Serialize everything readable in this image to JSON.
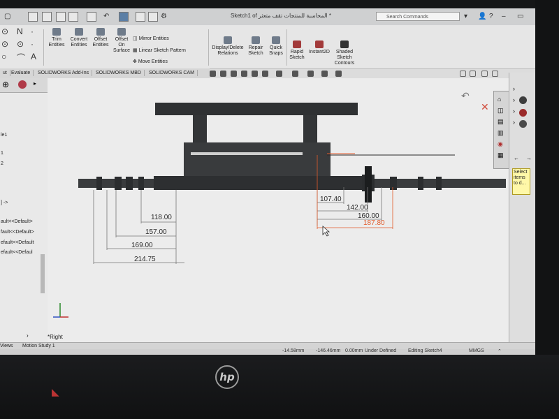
{
  "window": {
    "title": "Sketch1 of المحاسبة للمنتجات تقف متعثر *",
    "search_placeholder": "Search Commands"
  },
  "ribbon": {
    "trim": "Trim Entities",
    "convert": "Convert Entities",
    "offset": "Offset Entities",
    "offset_surface": "Offset On Surface",
    "mirror": "Mirror Entities",
    "linear_pattern": "Linear Sketch Pattern",
    "move": "Move Entities",
    "display_relations": "Display/Delete Relations",
    "repair": "Repair Sketch",
    "quick_snaps": "Quick Snaps",
    "rapid": "Rapid Sketch",
    "instant2d": "Instant2D",
    "shaded": "Shaded Sketch Contours"
  },
  "tabs": [
    "ut",
    "Evaluate",
    "SOLIDWORKS Add-Ins",
    "SOLIDWORKS MBD",
    "SOLIDWORKS CAM"
  ],
  "left_panel": {
    "items": [
      "le1",
      "1",
      "2",
      "] ->",
      "ault<<Default>",
      "fault<<Default>",
      "efault<<Default",
      "efault<<Defaul"
    ]
  },
  "dimensions": {
    "left": [
      "118.00",
      "157.00",
      "169.00",
      "214.75"
    ],
    "right": [
      "107.40",
      "142.00",
      "160.00"
    ],
    "active": "187.80"
  },
  "view_label": "*Right",
  "tooltip": "Select items to d...",
  "bottom_tabs": [
    "Views",
    "Motion Study 1"
  ],
  "status": {
    "x": "-14.58mm",
    "y": "-146.46mm",
    "z": "0.00mm",
    "state": "Under Defined",
    "editing": "Editing Sketch4",
    "units": "MMGS"
  },
  "brand": "hp"
}
